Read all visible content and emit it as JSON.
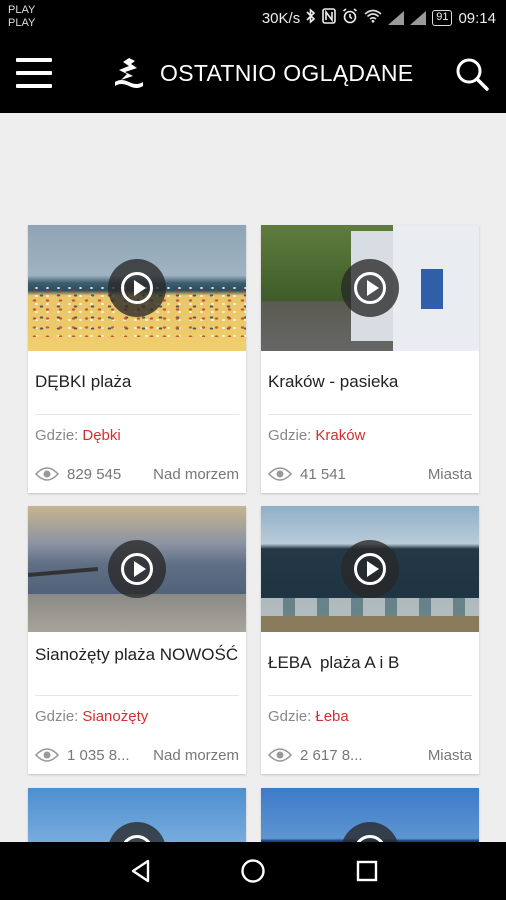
{
  "status_bar": {
    "carrier_line1": "PLAY",
    "carrier_line2": "PLAY",
    "net_speed": "30K/s",
    "battery": "91",
    "time": "09:14"
  },
  "app_bar": {
    "title": "OSTATNIO OGLĄDANE",
    "menu_icon": "hamburger-menu-icon",
    "logo_icon": "app-logo-icon",
    "search_icon": "search-icon"
  },
  "where_label": "Gdzie:",
  "cards": [
    {
      "name": "DĘBKI plaża",
      "place": "Dębki",
      "views": "829 545",
      "category": "Nad morzem"
    },
    {
      "name": "Kraków - pasieka",
      "place": "Kraków",
      "views": "41 541",
      "category": "Miasta"
    },
    {
      "name": "Sianożęty plaża NOWOŚĆ",
      "place": "Sianożęty",
      "views": "1 035 8...",
      "category": "Nad morzem"
    },
    {
      "name": "ŁEBA  plaża A i B",
      "place": "Łeba",
      "views": "2 617 8...",
      "category": "Miasta"
    }
  ],
  "colors": {
    "bar_background": "#000000",
    "content_background": "#eeeeee",
    "place_link": "#d32f2f"
  },
  "nav_bar": {
    "icons": [
      "back-icon",
      "home-icon",
      "recent-apps-icon"
    ]
  }
}
